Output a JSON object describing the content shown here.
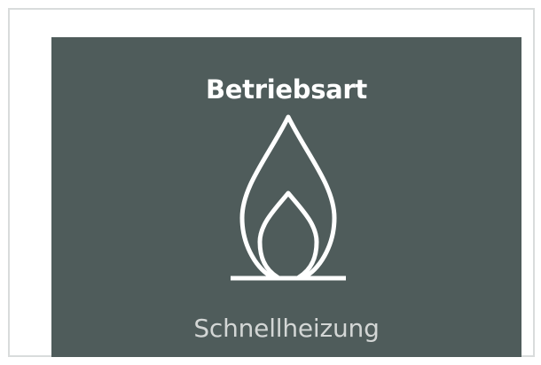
{
  "mode_tile": {
    "title": "Betriebsart",
    "value": "Schnellheizung",
    "icon": "flame-icon",
    "colors": {
      "tile_background": "#4f5c5b",
      "title_text": "#ffffff",
      "value_text": "#d3d6d5",
      "icon_stroke": "#ffffff",
      "frame_border": "#d9dcdc"
    }
  }
}
